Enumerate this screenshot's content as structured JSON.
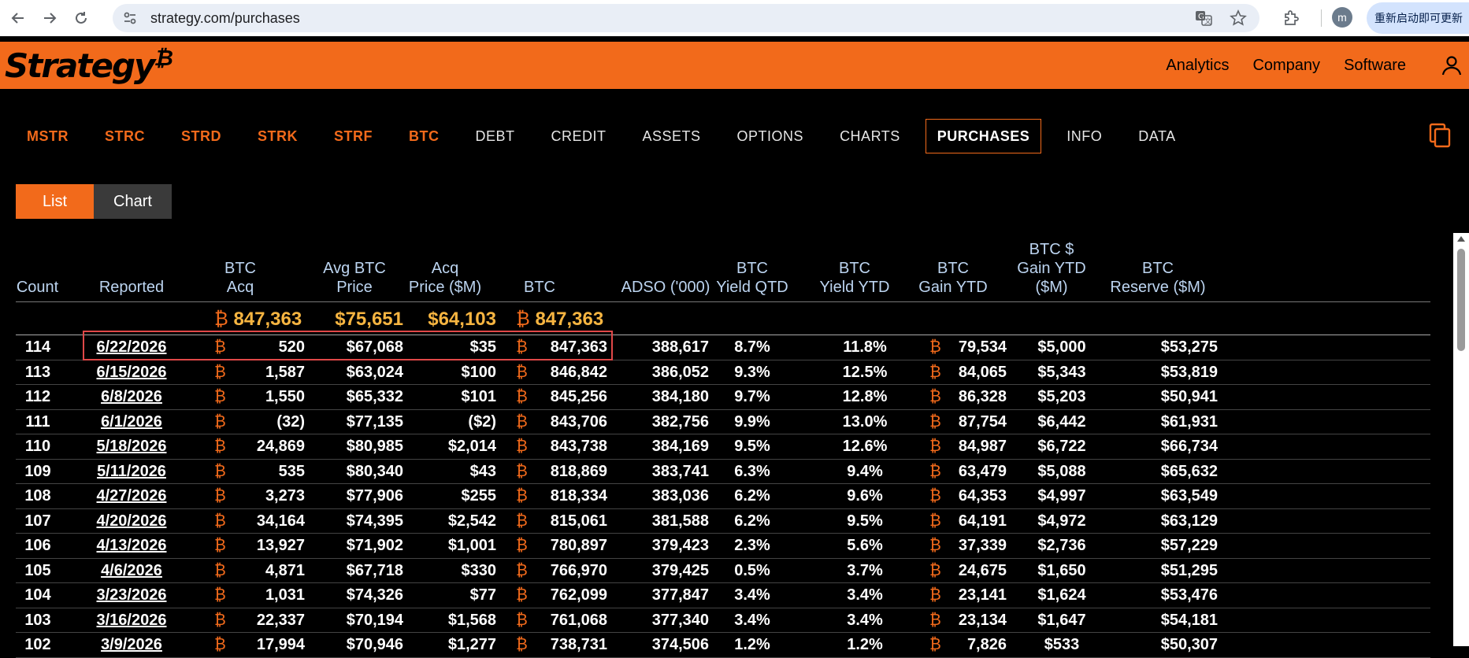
{
  "browser": {
    "url": "strategy.com/purchases",
    "profile_initial": "m",
    "update_label": "重新启动即可更新"
  },
  "site": {
    "logo": "Strategy",
    "logo_mark": "₿",
    "nav": [
      "Analytics",
      "Company",
      "Software"
    ]
  },
  "tabs": [
    {
      "label": "MSTR",
      "style": "orange"
    },
    {
      "label": "STRC",
      "style": "orange"
    },
    {
      "label": "STRD",
      "style": "orange"
    },
    {
      "label": "STRK",
      "style": "orange"
    },
    {
      "label": "STRF",
      "style": "orange"
    },
    {
      "label": "BTC",
      "style": "orange"
    },
    {
      "label": "DEBT",
      "style": "plain"
    },
    {
      "label": "CREDIT",
      "style": "plain"
    },
    {
      "label": "ASSETS",
      "style": "plain"
    },
    {
      "label": "OPTIONS",
      "style": "plain"
    },
    {
      "label": "CHARTS",
      "style": "plain"
    },
    {
      "label": "PURCHASES",
      "style": "active"
    },
    {
      "label": "INFO",
      "style": "plain"
    },
    {
      "label": "DATA",
      "style": "plain"
    }
  ],
  "toggle": {
    "list": "List",
    "chart": "Chart"
  },
  "table": {
    "headers": {
      "count": "Count",
      "reported": "Reported",
      "btc_acq": "BTC\nAcq",
      "avg_price": "Avg BTC\nPrice",
      "acq_price": "Acq\nPrice ($M)",
      "btc": "BTC",
      "adso": "ADSO ('000)",
      "yield_qtd": "BTC\nYield QTD",
      "yield_ytd": "BTC\nYield YTD",
      "gain_ytd": "BTC\nGain YTD",
      "gain_usd_ytd": "BTC $\nGain YTD\n($M)",
      "reserve": "BTC\nReserve ($M)"
    },
    "btc_symbol": "₿",
    "totals": {
      "btc_acq": "847,363",
      "avg_price": "$75,651",
      "acq_price": "$64,103",
      "btc": "847,363"
    },
    "rows": [
      {
        "count": "114",
        "reported": "6/22/2026",
        "btc_acq": "520",
        "avg_price": "$67,068",
        "acq_price": "$35",
        "btc": "847,363",
        "adso": "388,617",
        "yield_qtd": "8.7%",
        "yield_ytd": "11.8%",
        "gain_ytd": "79,534",
        "gain_usd_ytd": "$5,000",
        "reserve": "$53,275"
      },
      {
        "count": "113",
        "reported": "6/15/2026",
        "btc_acq": "1,587",
        "avg_price": "$63,024",
        "acq_price": "$100",
        "btc": "846,842",
        "adso": "386,052",
        "yield_qtd": "9.3%",
        "yield_ytd": "12.5%",
        "gain_ytd": "84,065",
        "gain_usd_ytd": "$5,343",
        "reserve": "$53,819"
      },
      {
        "count": "112",
        "reported": "6/8/2026",
        "btc_acq": "1,550",
        "avg_price": "$65,332",
        "acq_price": "$101",
        "btc": "845,256",
        "adso": "384,180",
        "yield_qtd": "9.7%",
        "yield_ytd": "12.8%",
        "gain_ytd": "86,328",
        "gain_usd_ytd": "$5,203",
        "reserve": "$50,941"
      },
      {
        "count": "111",
        "reported": "6/1/2026",
        "btc_acq": "(32)",
        "avg_price": "$77,135",
        "acq_price": "($2)",
        "btc": "843,706",
        "adso": "382,756",
        "yield_qtd": "9.9%",
        "yield_ytd": "13.0%",
        "gain_ytd": "87,754",
        "gain_usd_ytd": "$6,442",
        "reserve": "$61,931"
      },
      {
        "count": "110",
        "reported": "5/18/2026",
        "btc_acq": "24,869",
        "avg_price": "$80,985",
        "acq_price": "$2,014",
        "btc": "843,738",
        "adso": "384,169",
        "yield_qtd": "9.5%",
        "yield_ytd": "12.6%",
        "gain_ytd": "84,987",
        "gain_usd_ytd": "$6,722",
        "reserve": "$66,734"
      },
      {
        "count": "109",
        "reported": "5/11/2026",
        "btc_acq": "535",
        "avg_price": "$80,340",
        "acq_price": "$43",
        "btc": "818,869",
        "adso": "383,741",
        "yield_qtd": "6.3%",
        "yield_ytd": "9.4%",
        "gain_ytd": "63,479",
        "gain_usd_ytd": "$5,088",
        "reserve": "$65,632"
      },
      {
        "count": "108",
        "reported": "4/27/2026",
        "btc_acq": "3,273",
        "avg_price": "$77,906",
        "acq_price": "$255",
        "btc": "818,334",
        "adso": "383,036",
        "yield_qtd": "6.2%",
        "yield_ytd": "9.6%",
        "gain_ytd": "64,353",
        "gain_usd_ytd": "$4,997",
        "reserve": "$63,549"
      },
      {
        "count": "107",
        "reported": "4/20/2026",
        "btc_acq": "34,164",
        "avg_price": "$74,395",
        "acq_price": "$2,542",
        "btc": "815,061",
        "adso": "381,588",
        "yield_qtd": "6.2%",
        "yield_ytd": "9.5%",
        "gain_ytd": "64,191",
        "gain_usd_ytd": "$4,972",
        "reserve": "$63,129"
      },
      {
        "count": "106",
        "reported": "4/13/2026",
        "btc_acq": "13,927",
        "avg_price": "$71,902",
        "acq_price": "$1,001",
        "btc": "780,897",
        "adso": "379,423",
        "yield_qtd": "2.3%",
        "yield_ytd": "5.6%",
        "gain_ytd": "37,339",
        "gain_usd_ytd": "$2,736",
        "reserve": "$57,229"
      },
      {
        "count": "105",
        "reported": "4/6/2026",
        "btc_acq": "4,871",
        "avg_price": "$67,718",
        "acq_price": "$330",
        "btc": "766,970",
        "adso": "379,425",
        "yield_qtd": "0.5%",
        "yield_ytd": "3.7%",
        "gain_ytd": "24,675",
        "gain_usd_ytd": "$1,650",
        "reserve": "$51,295"
      },
      {
        "count": "104",
        "reported": "3/23/2026",
        "btc_acq": "1,031",
        "avg_price": "$74,326",
        "acq_price": "$77",
        "btc": "762,099",
        "adso": "377,847",
        "yield_qtd": "3.4%",
        "yield_ytd": "3.4%",
        "gain_ytd": "23,141",
        "gain_usd_ytd": "$1,624",
        "reserve": "$53,476"
      },
      {
        "count": "103",
        "reported": "3/16/2026",
        "btc_acq": "22,337",
        "avg_price": "$70,194",
        "acq_price": "$1,568",
        "btc": "761,068",
        "adso": "377,340",
        "yield_qtd": "3.4%",
        "yield_ytd": "3.4%",
        "gain_ytd": "23,134",
        "gain_usd_ytd": "$1,647",
        "reserve": "$54,181"
      },
      {
        "count": "102",
        "reported": "3/9/2026",
        "btc_acq": "17,994",
        "avg_price": "$70,946",
        "acq_price": "$1,277",
        "btc": "738,731",
        "adso": "374,506",
        "yield_qtd": "1.2%",
        "yield_ytd": "1.2%",
        "gain_ytd": "7,826",
        "gain_usd_ytd": "$533",
        "reserve": "$50,307"
      }
    ]
  },
  "colors": {
    "brand_orange": "#f26a1b",
    "totals_gold": "#f7b541",
    "header_blue": "#bcd4f0",
    "highlight_red": "#e04848"
  }
}
